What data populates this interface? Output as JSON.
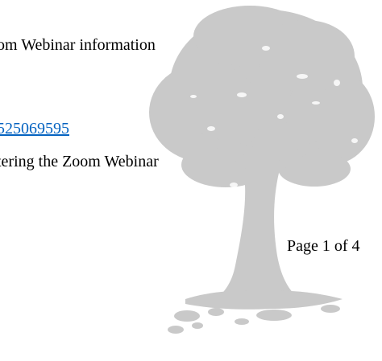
{
  "document": {
    "line_1": "om Webinar information",
    "link": "525069595",
    "line_3": "tering the Zoom Webinar",
    "page_number": "Page 1 of 4"
  },
  "watermark": {
    "icon": "tree-watermark-icon",
    "color": "#c9c9c9"
  },
  "colors": {
    "text": "#000000",
    "link": "#0563c1"
  }
}
